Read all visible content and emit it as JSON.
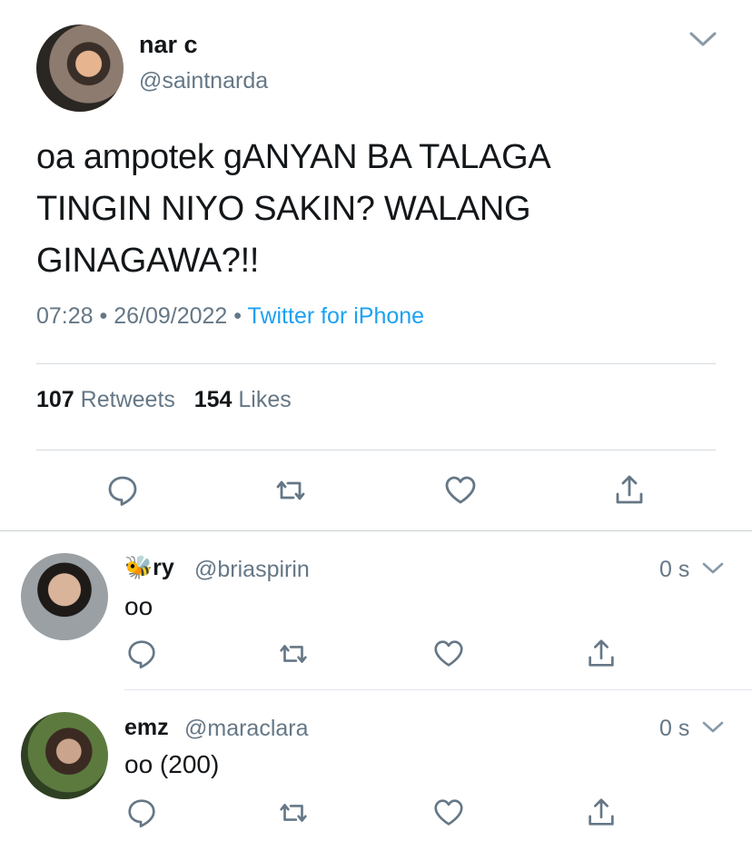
{
  "main": {
    "name": "nar c",
    "handle": "@saintnarda",
    "text": "oa ampotek gANYAN BA TALAGA TINGIN NIYO SAKIN? WALANG GINAGAWA?!!",
    "time": "07:28",
    "date": "26/09/2022",
    "source": "Twitter for iPhone",
    "retweets_count": "107",
    "retweets_label": "Retweets",
    "likes_count": "154",
    "likes_label": "Likes"
  },
  "replies": [
    {
      "emoji": "🐝",
      "name": "ry",
      "handle": "@briaspirin",
      "time": "0 s",
      "text": "oo"
    },
    {
      "name": "emz",
      "handle": "@maraclara",
      "time": "0 s",
      "text": "oo (200)"
    }
  ],
  "icons": {
    "reply": "speech-bubble",
    "retweet": "retweet-arrows",
    "like": "heart-outline",
    "share": "upload-arrow",
    "menu": "chevron-down"
  },
  "colors": {
    "link": "#1da1f2",
    "muted": "#657786",
    "text": "#14171a",
    "icon": "#657786"
  }
}
